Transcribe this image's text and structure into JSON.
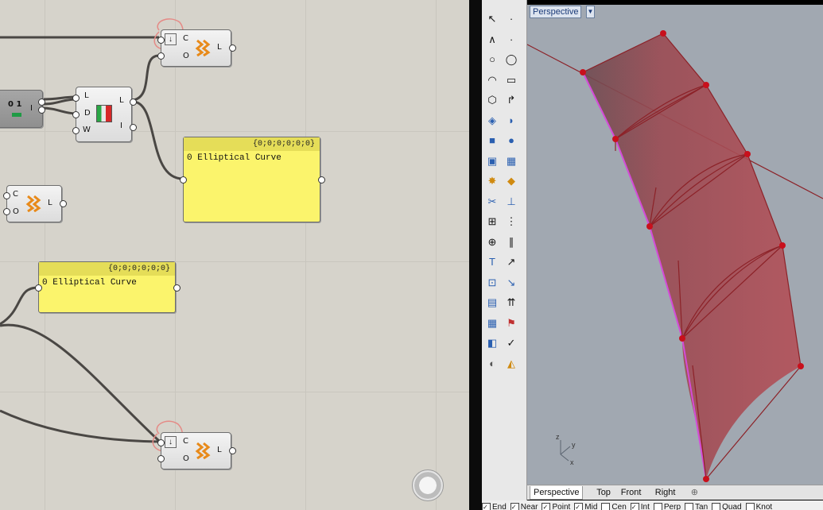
{
  "grasshopper": {
    "comp_top": {
      "input_c": "C",
      "input_o": "O",
      "output_l": "L"
    },
    "comp_bottom": {
      "input_c": "C",
      "input_o": "O",
      "output_l": "L"
    },
    "comp_left": {
      "input_c": "C",
      "input_o": "O",
      "output_l": "L"
    },
    "comp_mid": {
      "input_l": "L",
      "input_d": "D",
      "input_w": "W",
      "output_l": "L",
      "output_i": "I"
    },
    "comp_num": {
      "label": "0 1",
      "output": "I"
    },
    "panel1": {
      "path": "{0;0;0;0;0;0}",
      "index": "0",
      "content": "Elliptical Curve"
    },
    "panel2": {
      "path": "{0;0;0;0;0;0}",
      "index": "0",
      "content": "Elliptical Curve"
    }
  },
  "viewport": {
    "title": "Perspective",
    "axis_x": "x",
    "axis_y": "y",
    "axis_z": "z"
  },
  "view_tabs": [
    "Perspective",
    "Top",
    "Front",
    "Right"
  ],
  "osnaps": [
    "End",
    "Near",
    "Point",
    "Mid",
    "Cen",
    "Int",
    "Perp",
    "Tan",
    "Quad",
    "Knot"
  ],
  "toolbar_icons": [
    "select-icon",
    "point-icon",
    "polyline-icon",
    "curve-icon",
    "circle-icon",
    "ellipse-icon",
    "arc-icon",
    "rectangle-icon",
    "polygon-icon",
    "fillet-icon",
    "surface-icon",
    "loft-icon",
    "box-icon",
    "sphere-icon",
    "cylinder-icon",
    "mesh-icon",
    "explode-icon",
    "boolean-icon",
    "split-icon",
    "trim-icon",
    "group-icon",
    "array-icon",
    "join-icon",
    "offset-icon",
    "text-icon",
    "dimension-icon",
    "transform-icon",
    "analysis-icon",
    "render-icon",
    "properties-icon",
    "grid-icon",
    "snap-icon",
    "layer-icon",
    "check-icon",
    "shade-icon",
    "material-icon"
  ],
  "colors": {
    "canvas": "#d6d3cb",
    "panel": "#fbf46c",
    "surface": "#a8434a",
    "accent_pink": "#d44bd8"
  }
}
